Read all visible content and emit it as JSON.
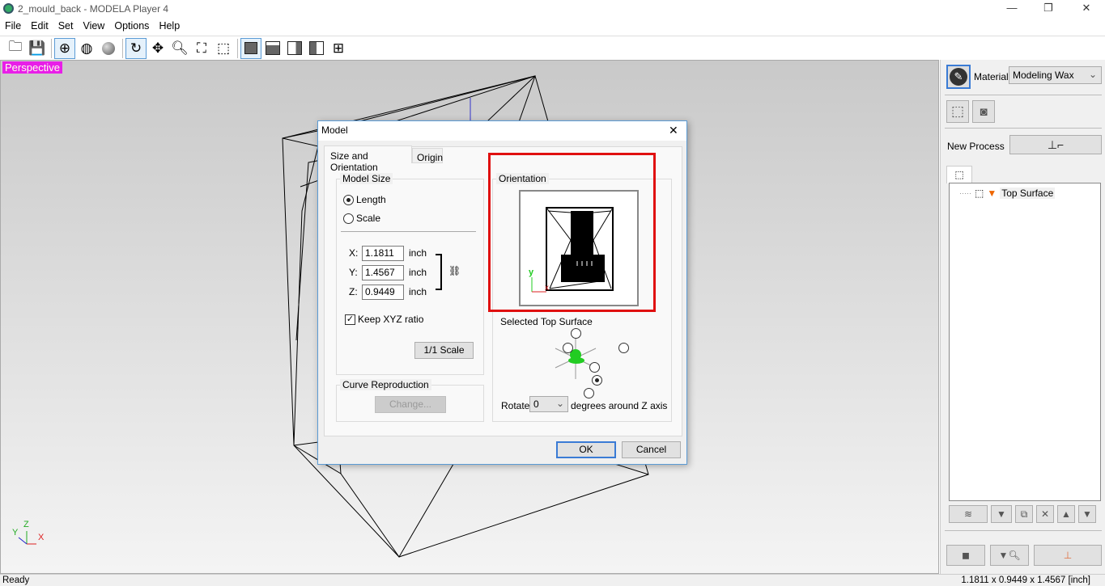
{
  "window": {
    "title": "2_mould_back - MODELA Player 4",
    "minimize": "—",
    "restore": "❐",
    "close": "✕"
  },
  "menu": [
    "File",
    "Edit",
    "Set",
    "View",
    "Options",
    "Help"
  ],
  "toolbar": {
    "icons": [
      "open-folder",
      "save",
      "wireframe-view",
      "shaded-wireframe-view",
      "solid-view",
      "rotate",
      "pan",
      "zoom",
      "fit-all",
      "fit-model",
      "view-iso",
      "view-top",
      "view-front",
      "view-side",
      "multi-view"
    ]
  },
  "viewport": {
    "label": "Perspective",
    "axes": {
      "z": "Z",
      "y": "Y",
      "x": "X"
    }
  },
  "status": {
    "left": "Ready",
    "right": "1.1811 x 0.9449 x 1.4567 [inch]"
  },
  "panel": {
    "material_label": "Material",
    "material_value": "Modeling Wax",
    "new_process_label": "New Process",
    "tree_item": "Top Surface"
  },
  "dialog": {
    "title": "Model",
    "close": "✕",
    "tabs": [
      "Size and Orientation",
      "Origin"
    ],
    "model_size": {
      "label": "Model Size",
      "length": "Length",
      "scale": "Scale",
      "fields": [
        {
          "axis": "X:",
          "value": "1.1811",
          "unit": "inch"
        },
        {
          "axis": "Y:",
          "value": "1.4567",
          "unit": "inch"
        },
        {
          "axis": "Z:",
          "value": "0.9449",
          "unit": "inch"
        }
      ],
      "keep_ratio": "Keep XYZ ratio",
      "keep_ratio_checked": true,
      "scale_button": "1/1 Scale",
      "selected": "Length"
    },
    "curve": {
      "label": "Curve Reproduction",
      "button": "Change..."
    },
    "orientation": {
      "label": "Orientation",
      "axis_y": "y",
      "axis_x": "x",
      "selected_label": "Selected Top Surface",
      "rotate_label": "Rotate",
      "rotate_value": "0",
      "rotate_suffix": "degrees around Z axis"
    },
    "ok": "OK",
    "cancel": "Cancel"
  },
  "colors": {
    "highlight": "#e01010",
    "perspective_bg": "#e81ee8",
    "accent": "#5b9bd5"
  }
}
